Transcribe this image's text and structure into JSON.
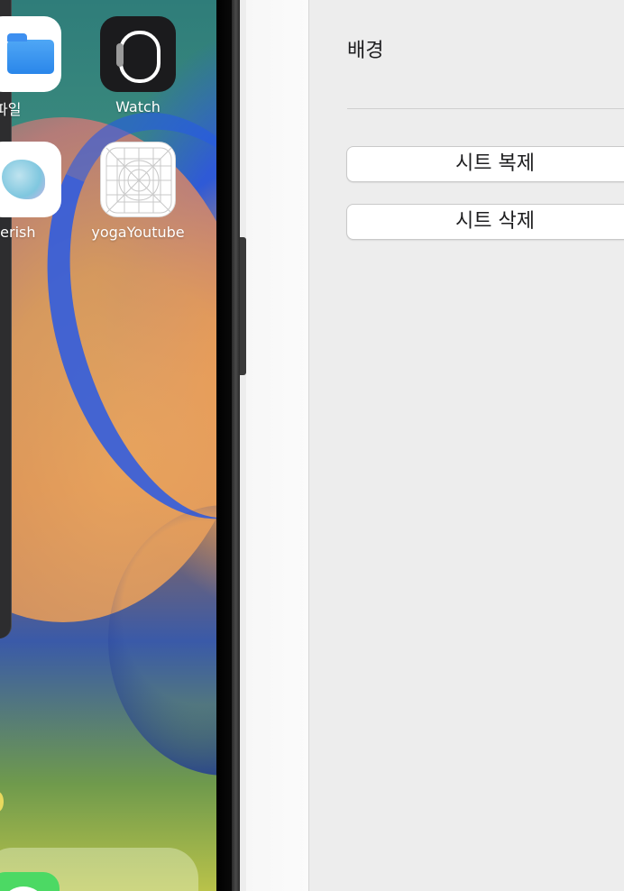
{
  "simulator": {
    "apps": [
      {
        "label": "파일",
        "icon": "files-folder-icon"
      },
      {
        "label": "Watch",
        "icon": "watch-icon"
      },
      {
        "label": "herish",
        "icon": "cherish-app-icon"
      },
      {
        "label": "yogaYoutube",
        "icon": "app-placeholder-grid-icon"
      }
    ]
  },
  "inspector": {
    "section_title": "배경",
    "buttons": {
      "duplicate_sheet": "시트 복제",
      "delete_sheet": "시트 삭제"
    }
  },
  "colors": {
    "inspector_bg": "#ededed",
    "button_bg": "#ffffff",
    "bezel": "#000000"
  }
}
